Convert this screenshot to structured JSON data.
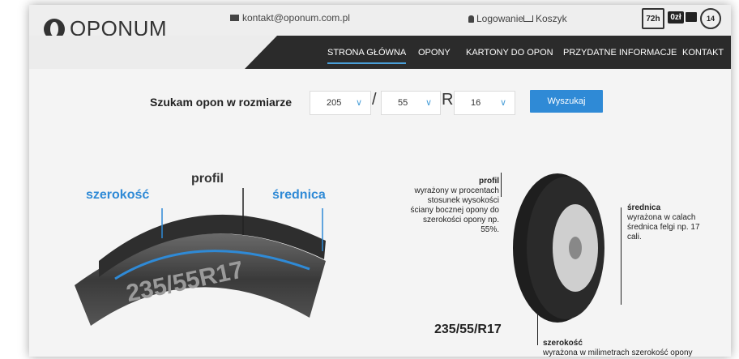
{
  "header": {
    "brand": "OPONUM",
    "email": "kontakt@oponum.com.pl",
    "login": "Logowanie",
    "cart": "Koszyk",
    "badges": {
      "hours": "72h",
      "zero": "0zł",
      "days": "14"
    }
  },
  "nav": {
    "items": [
      "STRONA GŁÓWNA",
      "OPONY",
      "KARTONY DO OPON",
      "PRZYDATNE INFORMACJE",
      "KONTAKT"
    ]
  },
  "search": {
    "label": "Szukam opon w rozmiarze",
    "width": "205",
    "profile": "55",
    "sep": "/",
    "r": "R",
    "rim": "16",
    "button": "Wyszukaj"
  },
  "illustration": {
    "labels": {
      "szerokosc": "szerokość",
      "profil": "profil",
      "srednica": "średnica"
    },
    "tread_text": "235/55R17",
    "size": "235/55/R17",
    "notes": {
      "profil_title": "profil",
      "profil_body": "wyrażony w procentach stosunek wysokości ściany bocznej opony do szerokości opony np. 55%.",
      "srednica_title": "średnica",
      "srednica_body": "wyrażona w calach średnica felgi np. 17 cali.",
      "szerokosc_title": "szerokość",
      "szerokosc_body": "wyrażona w milimetrach szerokość opony"
    }
  },
  "colors": {
    "accent": "#2f8ad6",
    "nav_bg": "#2b2b2b"
  }
}
